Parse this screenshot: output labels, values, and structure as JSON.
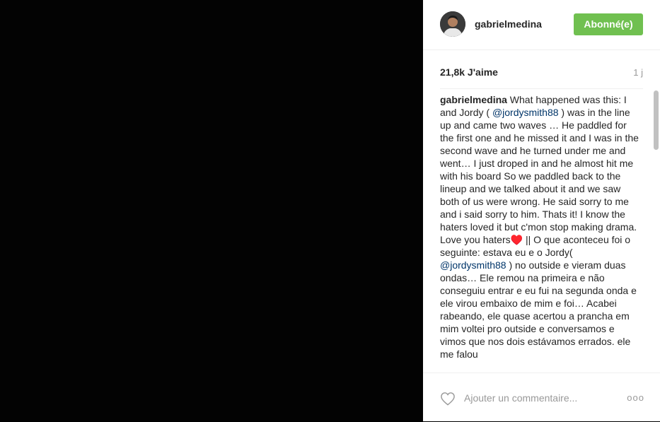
{
  "header": {
    "username": "gabrielmedina",
    "follow_label": "Abonné(e)"
  },
  "post": {
    "likes": "21,8k J'aime",
    "time": "1 j"
  },
  "caption": {
    "username": "gabrielmedina",
    "t1": " What happened was this: I and Jordy ( ",
    "m1": "@jordysmith88",
    "t2": " ) was in the line up and came two waves … He paddled for the first one and he missed it and I was in the second wave and he turned under me and went… I just droped in and he almost hit me with his board So we paddled back to the lineup and we talked about it and we saw both of us were wrong. He said sorry to me and i said sorry to him. Thats it! I know the haters loved it but c'mon stop making drama. Love you haters♥️ || O que aconteceu foi o seguinte: estava eu e o Jordy( ",
    "m2": "@jordysmith88",
    "t3": " ) no outside e vieram duas ondas… Ele remou na primeira e não conseguiu entrar e eu fui na segunda onda e ele virou embaixo de mim e foi… Acabei rabeando, ele quase acertou a prancha em mim voltei pro outside e conversamos e vimos que nos dois estávamos errados. ele me falou"
  },
  "footer": {
    "comment_placeholder": "Ajouter un commentaire...",
    "more_label": "ooo"
  },
  "colors": {
    "follow_button": "#70c050",
    "mention": "#003569",
    "media_background": "#030303"
  }
}
